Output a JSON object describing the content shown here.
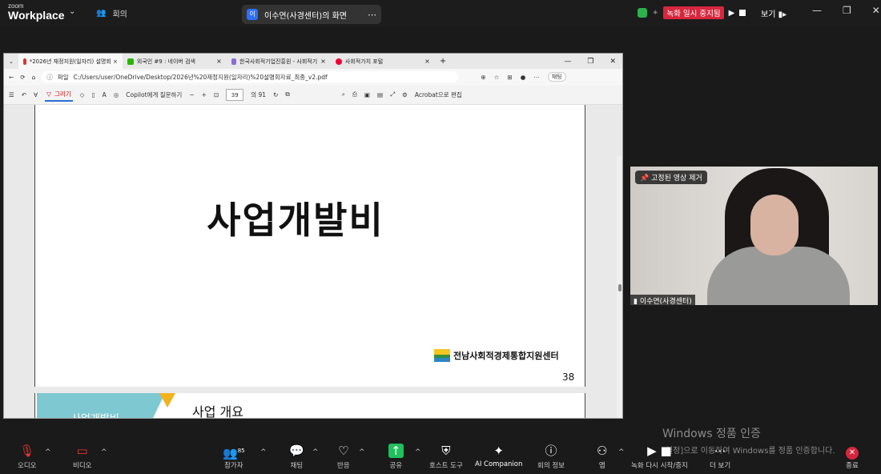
{
  "app": {
    "logo_line1": "zoom",
    "logo_line2": "Workplace",
    "meeting_label": "회의",
    "share_title": "이수연(사경센터)의 화면",
    "share_avatar": "이",
    "rec_status": "녹화 일시 중지됨",
    "view": "보기"
  },
  "browser": {
    "tabs": [
      {
        "label": "*2026년 재정지원(일자리) 설명회 ×",
        "color": "#d33"
      },
      {
        "label": "외국인 #9 : 네이버 검색",
        "color": "#2db400"
      },
      {
        "label": "한국사회적기업진흥원 - 사회적기",
        "color": "#8c6bd6"
      },
      {
        "label": "사회적가치 포털",
        "color": "#e03"
      }
    ],
    "url_prefix": "파일",
    "url": "C:/Users/user/OneDrive/Desktop/2026년%20재정지원(일자리)%20설명회자료_최종_v2.pdf",
    "chat_label": "채팅"
  },
  "pdf": {
    "draw_label": "그리기",
    "copilot_label": "Copilot에게 질문하기",
    "page_current": "39",
    "page_total": "의 91",
    "acrobat_label": "Acrobat으로 편집",
    "slide_title": "사업개발비",
    "org_name": "전남사회적경제통합지원센터",
    "page_number": "38",
    "next_tab_text": "사업개발비",
    "next_heading": "사업 개요"
  },
  "video": {
    "pin_label": "고정된 영상 제거",
    "name": "이수연(사경센터)"
  },
  "watermark": {
    "line1": "Windows 정품 인증",
    "line2": "[설정]으로 이동하여 Windows를 정품 인증합니다."
  },
  "toolbar": {
    "audio": "오디오",
    "video": "비디오",
    "participants": "참가자",
    "participants_count": "85",
    "chat": "채팅",
    "reactions": "반응",
    "share": "공유",
    "host_tools": "호스트 도구",
    "ai": "AI Companion",
    "info": "회의 정보",
    "apps": "앱",
    "record": "녹화 다시 시작/중지",
    "more": "더 보기",
    "end": "종료"
  },
  "colors": {
    "share_green": "#20c05c",
    "record_red": "#d7263d"
  }
}
